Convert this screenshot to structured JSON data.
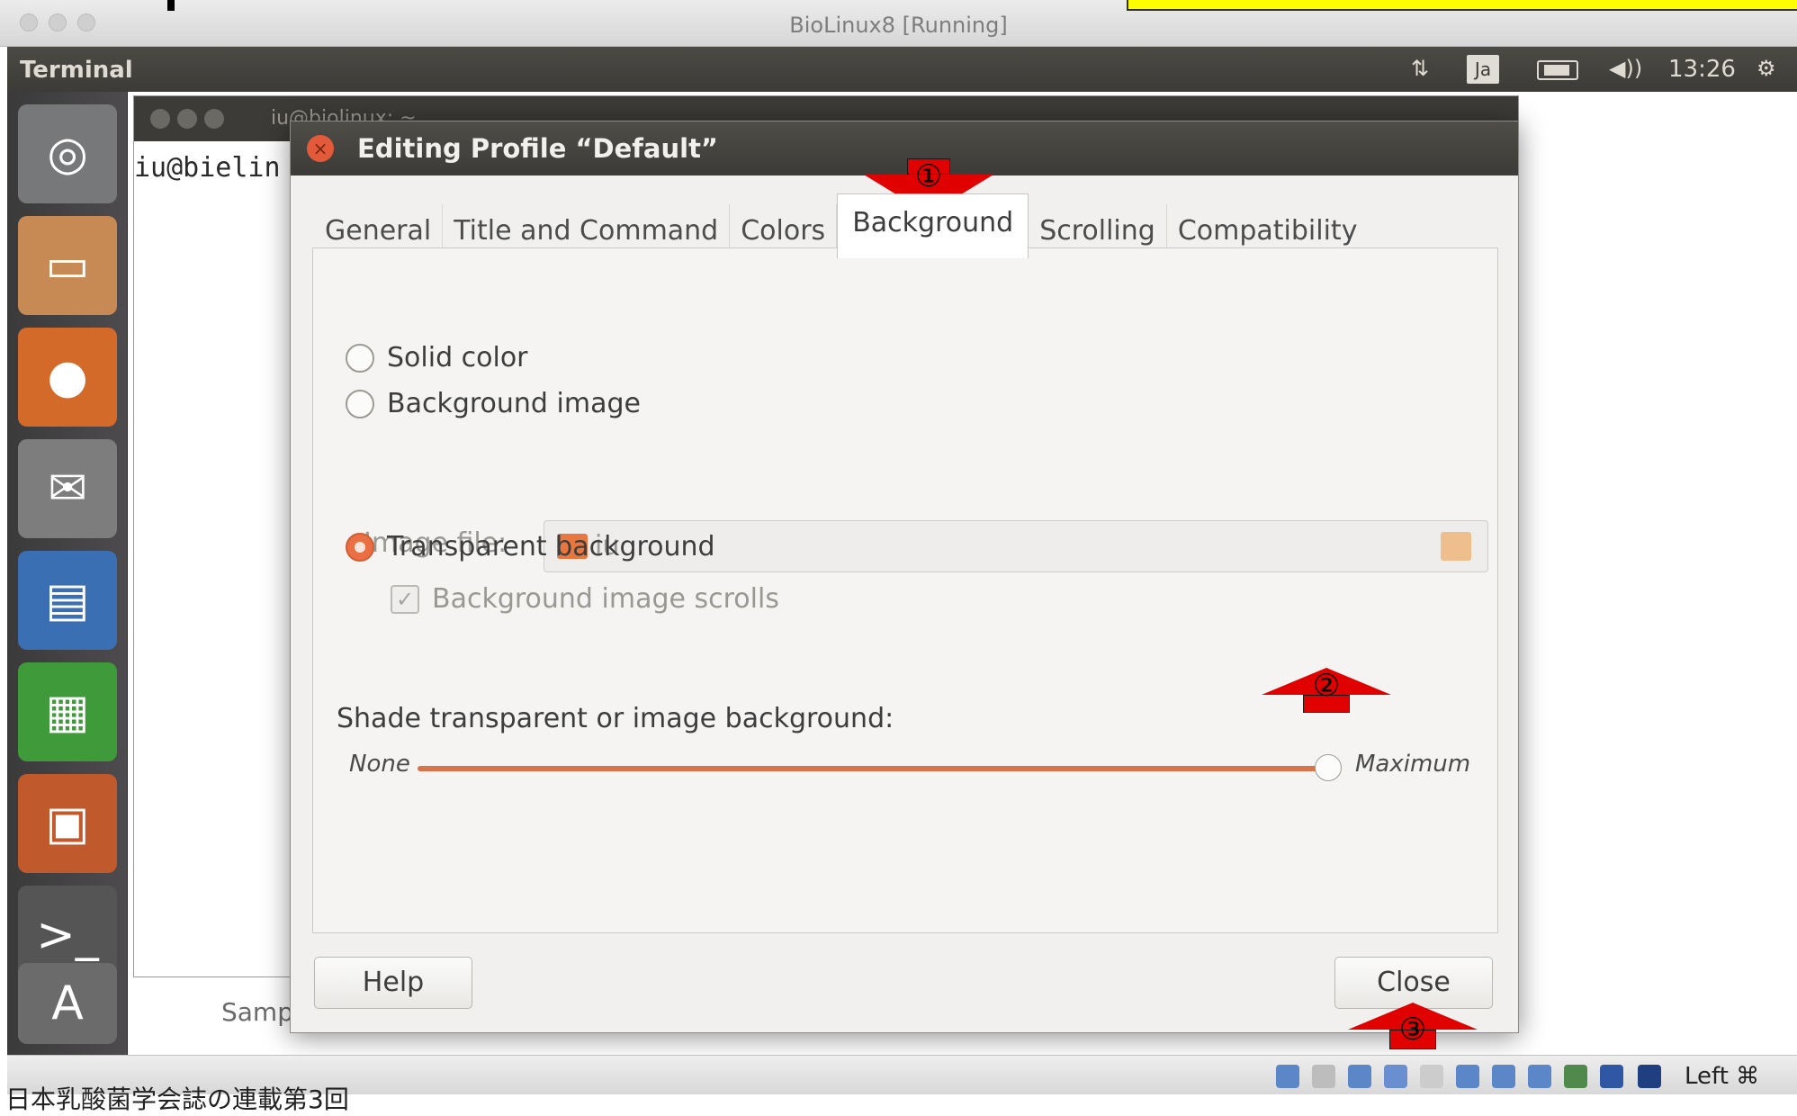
{
  "mac": {
    "window_title": "BioLinux8 [Running]"
  },
  "panel": {
    "app_name": "Terminal",
    "input_method": "Ja",
    "clock": "13:26"
  },
  "terminal": {
    "title": "iu@biolinux: ~",
    "prompt": "iu@bielin",
    "footer_text": "Samp"
  },
  "dialog": {
    "title": "Editing Profile “Default”",
    "tabs": [
      "General",
      "Title and Command",
      "Colors",
      "Background",
      "Scrolling",
      "Compatibility"
    ],
    "active_tab": "Background",
    "radio_solid": "Solid color",
    "radio_bg_image": "Background image",
    "image_file_label": "Image file:",
    "image_file_value": "iu",
    "bg_image_scrolls": "Background image scrolls",
    "radio_transparent": "Transparent background",
    "selected_option": "Transparent background",
    "shade_label": "Shade transparent or image background:",
    "slider_min": "None",
    "slider_max": "Maximum",
    "slider_value": 1.0,
    "help_button": "Help",
    "close_button": "Close"
  },
  "annotations": {
    "arrow1": "①",
    "arrow2": "②",
    "arrow3": "③"
  },
  "vbox": {
    "host_key": "Left ⌘"
  },
  "caption": "日本乳酸菌学会誌の連載第3回",
  "colors": {
    "accent": "#e8703f",
    "annotation": "#e00000",
    "highlight": "#ffff00"
  }
}
